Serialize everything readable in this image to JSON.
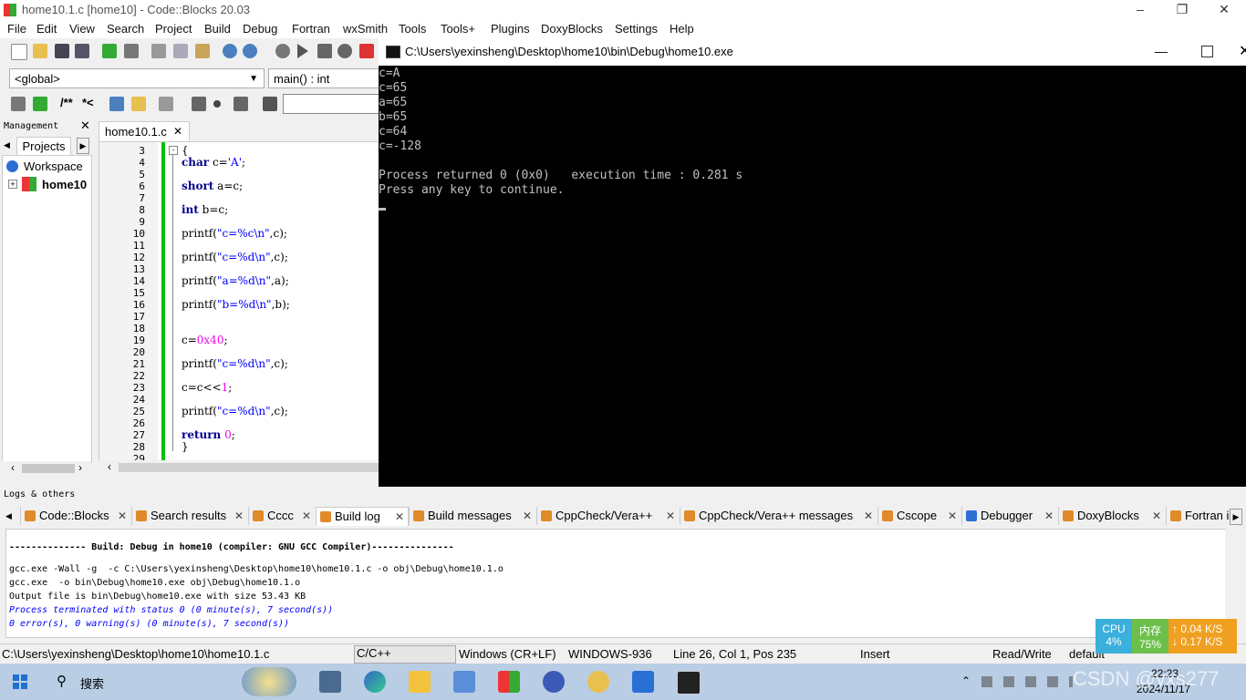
{
  "window": {
    "title": "home10.1.c [home10] - Code::Blocks 20.03"
  },
  "menu": [
    "File",
    "Edit",
    "View",
    "Search",
    "Project",
    "Build",
    "Debug",
    "Fortran",
    "wxSmith",
    "Tools",
    "Tools+",
    "Plugins",
    "DoxyBlocks",
    "Settings",
    "Help"
  ],
  "scope_combo": "<global>",
  "func_combo": "main() : int",
  "toolbar3": {
    "comment_label": "/**",
    "stream_label": "*<"
  },
  "management": {
    "title": "Management",
    "tab": "Projects",
    "workspace": "Workspace",
    "project": "home10"
  },
  "editor": {
    "tab": "home10.1.c",
    "line_numbers": [
      "3",
      "4",
      "5",
      "6",
      "7",
      "8",
      "9",
      "10",
      "11",
      "12",
      "13",
      "14",
      "15",
      "16",
      "17",
      "18",
      "19",
      "20",
      "21",
      "22",
      "23",
      "24",
      "25",
      "26",
      "27",
      "28",
      "29"
    ],
    "code": [
      {
        "line": "3",
        "parts": [
          {
            "t": "{",
            "c": "p"
          }
        ]
      },
      {
        "line": "4",
        "parts": [
          {
            "t": "char",
            "c": "kw"
          },
          {
            "t": " c=",
            "c": "p"
          },
          {
            "t": "'A'",
            "c": "str"
          },
          {
            "t": ";",
            "c": "p"
          }
        ]
      },
      {
        "line": "6",
        "parts": [
          {
            "t": "short",
            "c": "kw"
          },
          {
            "t": " a=c;",
            "c": "p"
          }
        ]
      },
      {
        "line": "8",
        "parts": [
          {
            "t": "int",
            "c": "kw"
          },
          {
            "t": " b=c;",
            "c": "p"
          }
        ]
      },
      {
        "line": "10",
        "parts": [
          {
            "t": "printf(",
            "c": "p"
          },
          {
            "t": "\"c=%c\\n\"",
            "c": "str"
          },
          {
            "t": ",c);",
            "c": "p"
          }
        ]
      },
      {
        "line": "12",
        "parts": [
          {
            "t": "printf(",
            "c": "p"
          },
          {
            "t": "\"c=%d\\n\"",
            "c": "str"
          },
          {
            "t": ",c);",
            "c": "p"
          }
        ]
      },
      {
        "line": "14",
        "parts": [
          {
            "t": "printf(",
            "c": "p"
          },
          {
            "t": "\"a=%d\\n\"",
            "c": "str"
          },
          {
            "t": ",a);",
            "c": "p"
          }
        ]
      },
      {
        "line": "16",
        "parts": [
          {
            "t": "printf(",
            "c": "p"
          },
          {
            "t": "\"b=%d\\n\"",
            "c": "str"
          },
          {
            "t": ",b);",
            "c": "p"
          }
        ]
      },
      {
        "line": "19",
        "parts": [
          {
            "t": "c=",
            "c": "p"
          },
          {
            "t": "0x40",
            "c": "num"
          },
          {
            "t": ";",
            "c": "p"
          }
        ]
      },
      {
        "line": "21",
        "parts": [
          {
            "t": "printf(",
            "c": "p"
          },
          {
            "t": "\"c=%d\\n\"",
            "c": "str"
          },
          {
            "t": ",c);",
            "c": "p"
          }
        ]
      },
      {
        "line": "23",
        "parts": [
          {
            "t": "c=c<<",
            "c": "p"
          },
          {
            "t": "1",
            "c": "num"
          },
          {
            "t": ";",
            "c": "p"
          }
        ]
      },
      {
        "line": "25",
        "parts": [
          {
            "t": "printf(",
            "c": "p"
          },
          {
            "t": "\"c=%d\\n\"",
            "c": "str"
          },
          {
            "t": ",c);",
            "c": "p"
          }
        ]
      },
      {
        "line": "27",
        "parts": [
          {
            "t": "return",
            "c": "kw"
          },
          {
            "t": " ",
            "c": "p"
          },
          {
            "t": "0",
            "c": "num"
          },
          {
            "t": ";",
            "c": "p"
          }
        ]
      },
      {
        "line": "28",
        "parts": [
          {
            "t": "}",
            "c": "p"
          }
        ]
      }
    ]
  },
  "console": {
    "title": "C:\\Users\\yexinsheng\\Desktop\\home10\\bin\\Debug\\home10.exe",
    "lines": [
      "c=A",
      "c=65",
      "a=65",
      "b=65",
      "c=64",
      "c=-128",
      "",
      "Process returned 0 (0x0)   execution time : 0.281 s",
      "Press any key to continue."
    ]
  },
  "logs": {
    "title": "Logs & others",
    "tabs": [
      "Code::Blocks",
      "Search results",
      "Cccc",
      "Build log",
      "Build messages",
      "CppCheck/Vera++",
      "CppCheck/Vera++ messages",
      "Cscope",
      "Debugger",
      "DoxyBlocks",
      "Fortran i"
    ],
    "lines": [
      {
        "text": "-------------- Build: Debug in home10 (compiler: GNU GCC Compiler)---------------",
        "style": "bold"
      },
      {
        "text": "gcc.exe -Wall -g  -c C:\\Users\\yexinsheng\\Desktop\\home10\\home10.1.c -o obj\\Debug\\home10.1.o",
        "style": "normal"
      },
      {
        "text": "gcc.exe  -o bin\\Debug\\home10.exe obj\\Debug\\home10.1.o",
        "style": "normal"
      },
      {
        "text": "Output file is bin\\Debug\\home10.exe with size 53.43 KB",
        "style": "normal"
      },
      {
        "text": "Process terminated with status 0 (0 minute(s), 7 second(s))",
        "style": "blue"
      },
      {
        "text": "0 error(s), 0 warning(s) (0 minute(s), 7 second(s))",
        "style": "blue"
      }
    ]
  },
  "status": {
    "path": "C:\\Users\\yexinsheng\\Desktop\\home10\\home10.1.c",
    "lang": "C/C++",
    "eol": "Windows (CR+LF)",
    "encoding": "WINDOWS-936",
    "position": "Line 26, Col 1, Pos 235",
    "mode": "Insert",
    "rw": "Read/Write",
    "theme": "default"
  },
  "monitor": {
    "cpu_label": "CPU",
    "cpu": "4%",
    "mem_label": "内存",
    "mem": "75%",
    "up": "0.04 K/S",
    "down": "0.17 K/S"
  },
  "taskbar": {
    "search": "搜索",
    "time": "22:23",
    "date": "2024/11/17",
    "watermark": "CSDN @yxs277"
  },
  "colors": {
    "accent": "#0078d7",
    "keyword": "#00008b",
    "string": "#0000ff",
    "number": "#f000f0"
  }
}
